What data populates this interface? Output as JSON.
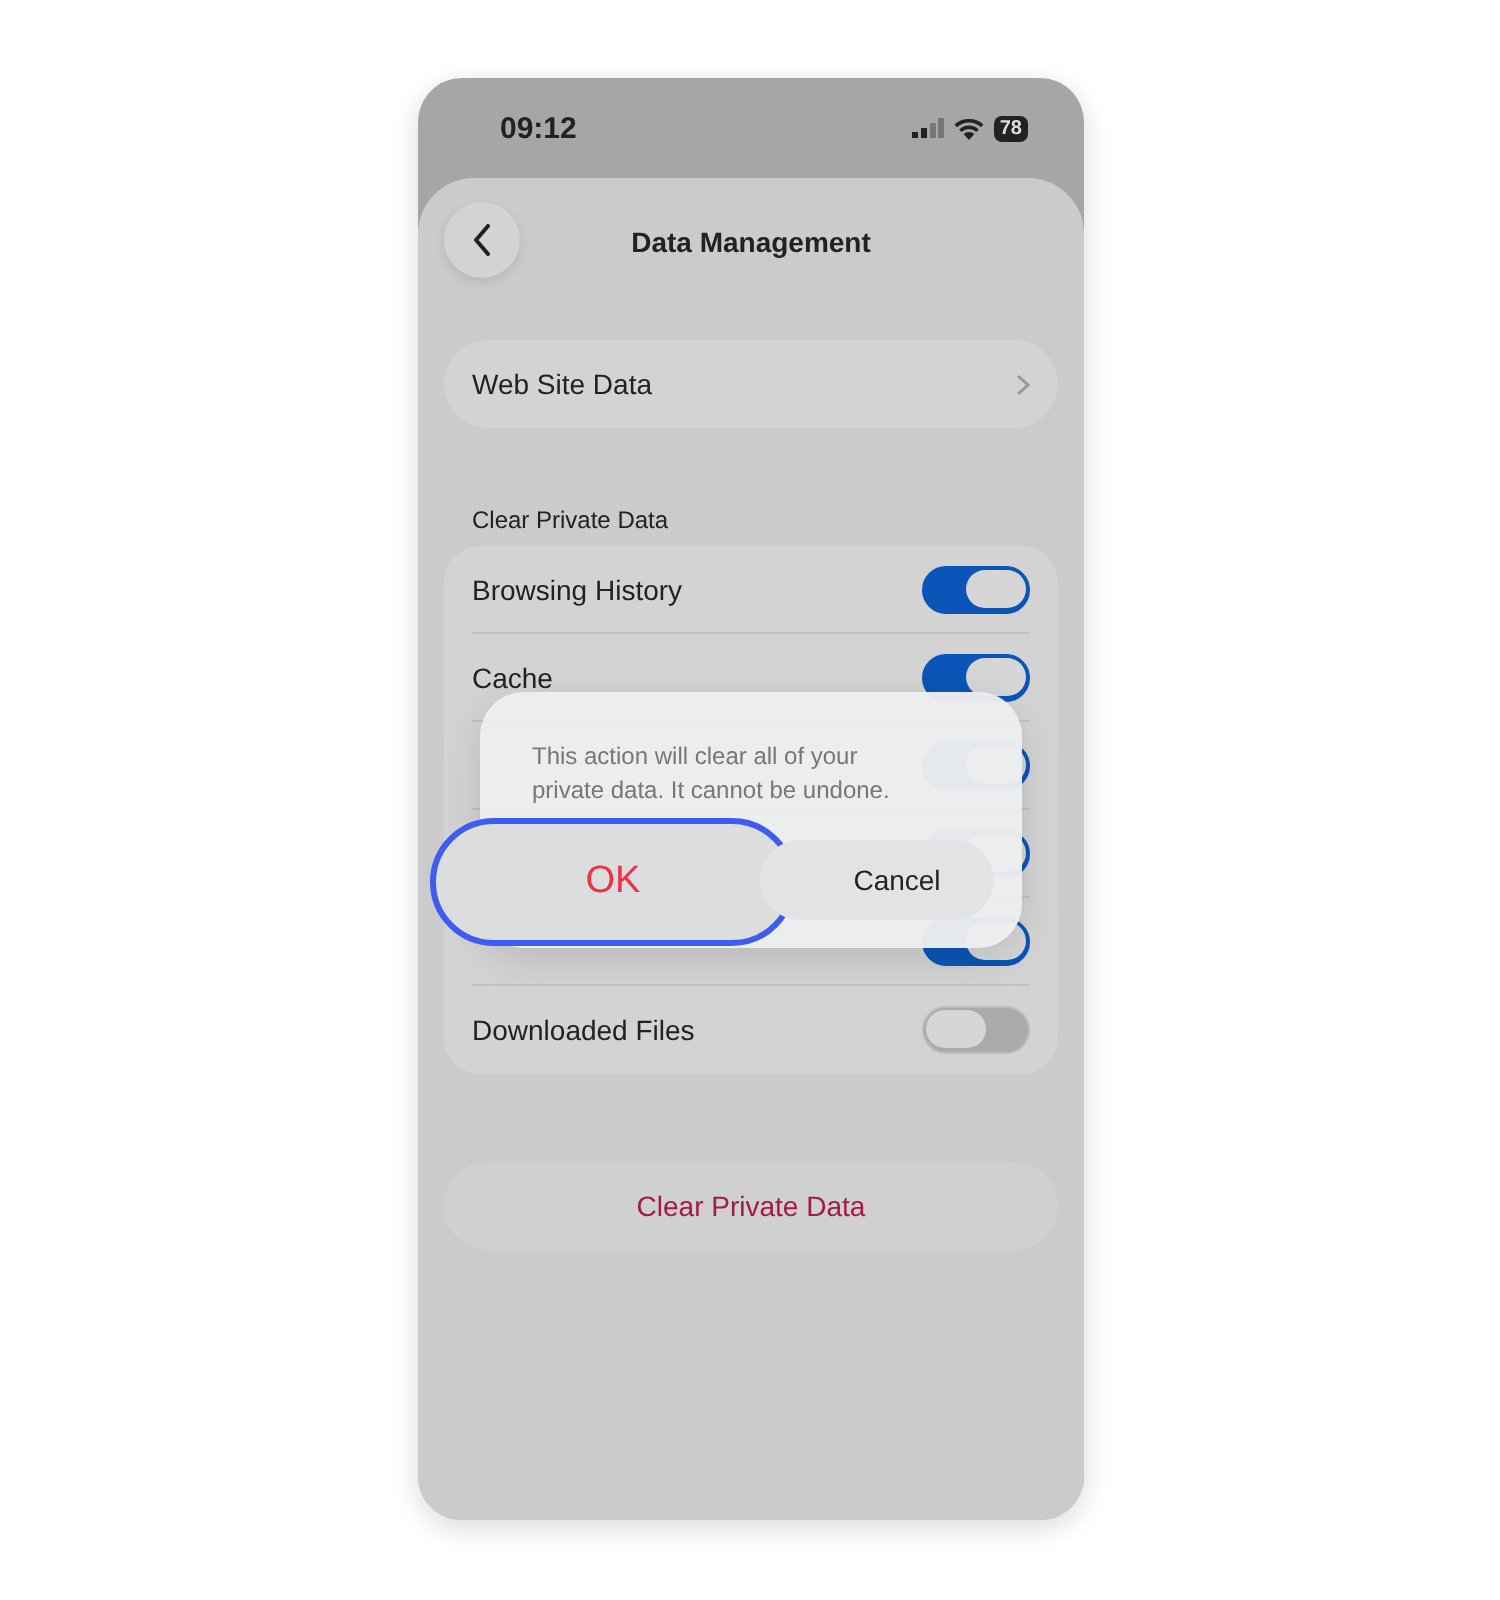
{
  "status_bar": {
    "time": "09:12",
    "battery": "78"
  },
  "header": {
    "title": "Data Management"
  },
  "website_row": {
    "label": "Web Site Data"
  },
  "section": {
    "title": "Clear Private Data"
  },
  "toggles": [
    {
      "label": "Browsing History",
      "on": true
    },
    {
      "label": "Cache",
      "on": true
    },
    {
      "on": true
    },
    {
      "on": true
    },
    {
      "on": true
    },
    {
      "label": "Downloaded Files",
      "on": false
    }
  ],
  "clear_button": {
    "label": "Clear Private Data"
  },
  "dialog": {
    "message": "This action will clear all of your private data. It cannot be undone.",
    "buttons": [
      {
        "label": "OK",
        "kind": "primary",
        "selected": true
      },
      {
        "label": "Cancel",
        "kind": "secondary",
        "selected": false
      }
    ]
  }
}
